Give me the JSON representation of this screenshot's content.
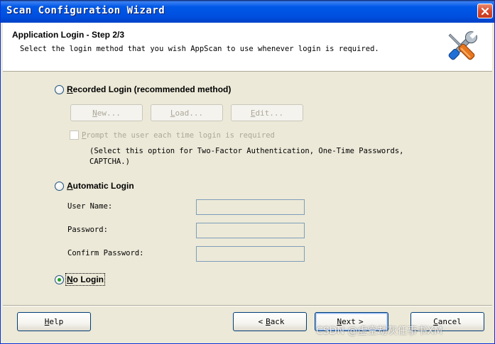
{
  "window": {
    "title": "Scan Configuration Wizard"
  },
  "header": {
    "step_title": "Application Login - Step 2/3",
    "step_description": "Select the login method that you wish AppScan to use whenever login is required."
  },
  "recorded_login": {
    "label_first": "R",
    "label_rest": "ecorded Login (recommended method)",
    "checked": false,
    "new_first": "N",
    "new_rest": "ew...",
    "load_first": "L",
    "load_rest": "oad...",
    "edit_first": "E",
    "edit_rest": "dit...",
    "prompt_first": "P",
    "prompt_rest": "rompt the user each time login is required",
    "prompt_checked": false,
    "note": "(Select this option for Two-Factor Authentication, One-Time Passwords, CAPTCHA.)"
  },
  "automatic_login": {
    "label_first": "A",
    "label_rest": "utomatic Login",
    "checked": false,
    "user_name_label": "User Name:",
    "user_name_value": "",
    "password_label": "Password:",
    "password_value": "",
    "confirm_password_label": "Confirm Password:",
    "confirm_password_value": ""
  },
  "no_login": {
    "label_first": "N",
    "label_rest": "o Login",
    "checked": true
  },
  "footer": {
    "help_first": "H",
    "help_rest": "elp",
    "back_first": "B",
    "back_rest": "ack",
    "next_first": "N",
    "next_rest": "ext",
    "cancel_first": "C",
    "cancel_rest": "ancel"
  },
  "watermark": "CSDN @虚空劫灰任事书XM",
  "colors": {
    "titlebar": "#0054e3",
    "dialog_bg": "#ece9d8",
    "header_bg": "#ffffff",
    "disabled_text": "#aca899",
    "radio_dot": "#21a121"
  }
}
